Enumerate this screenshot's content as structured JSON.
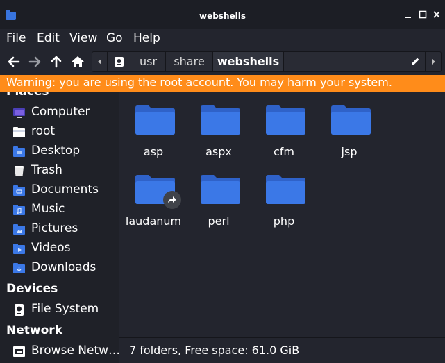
{
  "window": {
    "title": "webshells"
  },
  "menubar": {
    "items": [
      "File",
      "Edit",
      "View",
      "Go",
      "Help"
    ]
  },
  "pathbar": {
    "segments": [
      "usr",
      "share",
      "webshells"
    ]
  },
  "warning": {
    "text": "Warning: you are using the root account. You may harm your system."
  },
  "sidebar": {
    "places_heading": "Places",
    "places": [
      {
        "label": "Computer",
        "icon": "computer-icon"
      },
      {
        "label": "root",
        "icon": "home-folder-icon"
      },
      {
        "label": "Desktop",
        "icon": "desktop-folder-icon"
      },
      {
        "label": "Trash",
        "icon": "trash-icon"
      },
      {
        "label": "Documents",
        "icon": "documents-folder-icon"
      },
      {
        "label": "Music",
        "icon": "music-folder-icon"
      },
      {
        "label": "Pictures",
        "icon": "pictures-folder-icon"
      },
      {
        "label": "Videos",
        "icon": "videos-folder-icon"
      },
      {
        "label": "Downloads",
        "icon": "downloads-folder-icon"
      }
    ],
    "devices_heading": "Devices",
    "devices": [
      {
        "label": "File System",
        "icon": "drive-icon"
      }
    ],
    "network_heading": "Network",
    "network": [
      {
        "label": "Browse Netw…",
        "icon": "network-icon"
      }
    ]
  },
  "files": [
    {
      "name": "asp",
      "type": "folder"
    },
    {
      "name": "aspx",
      "type": "folder"
    },
    {
      "name": "cfm",
      "type": "folder"
    },
    {
      "name": "jsp",
      "type": "folder"
    },
    {
      "name": "laudanum",
      "type": "folder-symlink"
    },
    {
      "name": "perl",
      "type": "folder"
    },
    {
      "name": "php",
      "type": "folder"
    }
  ],
  "statusbar": {
    "text": "7 folders, Free space: 61.0 GiB"
  },
  "colors": {
    "warning": "#ff8c1a",
    "folder": "#3b78e7",
    "sidebar_bg": "#1f2128",
    "main_bg": "#23252e"
  }
}
